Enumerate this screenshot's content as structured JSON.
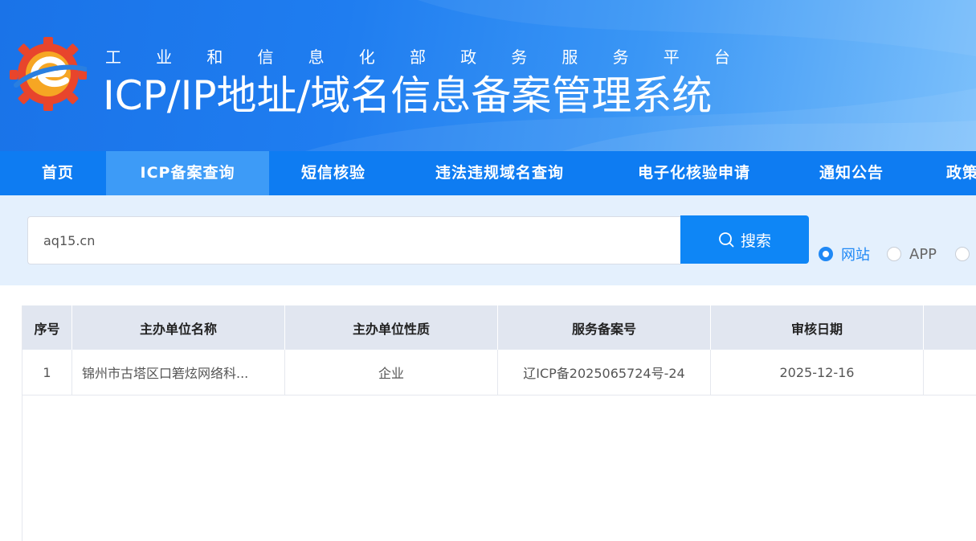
{
  "header": {
    "subtitle_chars": [
      "工",
      "业",
      "和",
      "信",
      "息",
      "化",
      "部",
      "政",
      "务",
      "服",
      "务",
      "平",
      "台"
    ],
    "title": "ICP/IP地址/域名信息备案管理系统"
  },
  "nav": {
    "items": [
      {
        "label": "首页",
        "active": false
      },
      {
        "label": "ICP备案查询",
        "active": true
      },
      {
        "label": "短信核验",
        "active": false
      },
      {
        "label": "违法违规域名查询",
        "active": false
      },
      {
        "label": "电子化核验申请",
        "active": false
      },
      {
        "label": "通知公告",
        "active": false
      },
      {
        "label": "政策",
        "active": false
      }
    ]
  },
  "search": {
    "value": "aq15.cn",
    "button_label": "搜索",
    "options": [
      {
        "label": "网站",
        "checked": true
      },
      {
        "label": "APP",
        "checked": false
      },
      {
        "label": "",
        "checked": false
      }
    ]
  },
  "table": {
    "columns": [
      "序号",
      "主办单位名称",
      "主办单位性质",
      "服务备案号",
      "审核日期",
      ""
    ],
    "rows": [
      [
        "1",
        "锦州市古塔区口箬炫网络科...",
        "企业",
        "辽ICP备2025065724号-24",
        "2025-12-16",
        ""
      ]
    ]
  },
  "colors": {
    "nav_bg": "#0e7cf2",
    "nav_active": "#3d9bf7",
    "accent": "#1f88f5",
    "band_bg": "#e4f0fd"
  }
}
